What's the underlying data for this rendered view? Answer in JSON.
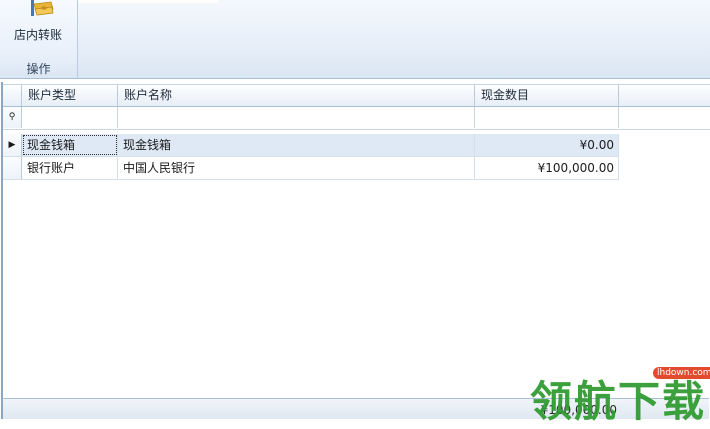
{
  "ribbon": {
    "button_label": "店内转账",
    "group_label": "操作"
  },
  "grid": {
    "columns": [
      "账户类型",
      "账户名称",
      "现金数目"
    ],
    "filter_icon": "filter-pin-icon",
    "rows": [
      {
        "type": "现金钱箱",
        "name": "现金钱箱",
        "amount": "¥0.00",
        "selected": true
      },
      {
        "type": "银行账户",
        "name": "中国人民银行",
        "amount": "¥100,000.00",
        "selected": false
      }
    ]
  },
  "footer": {
    "total": "¥100,000.00"
  },
  "watermark": {
    "text": "领航下载",
    "site": "lhdown.com"
  },
  "colors": {
    "ribbon_bg": "#e6eef8",
    "selected_row": "#dfe9f6",
    "watermark_green": "#2c9a2c"
  }
}
